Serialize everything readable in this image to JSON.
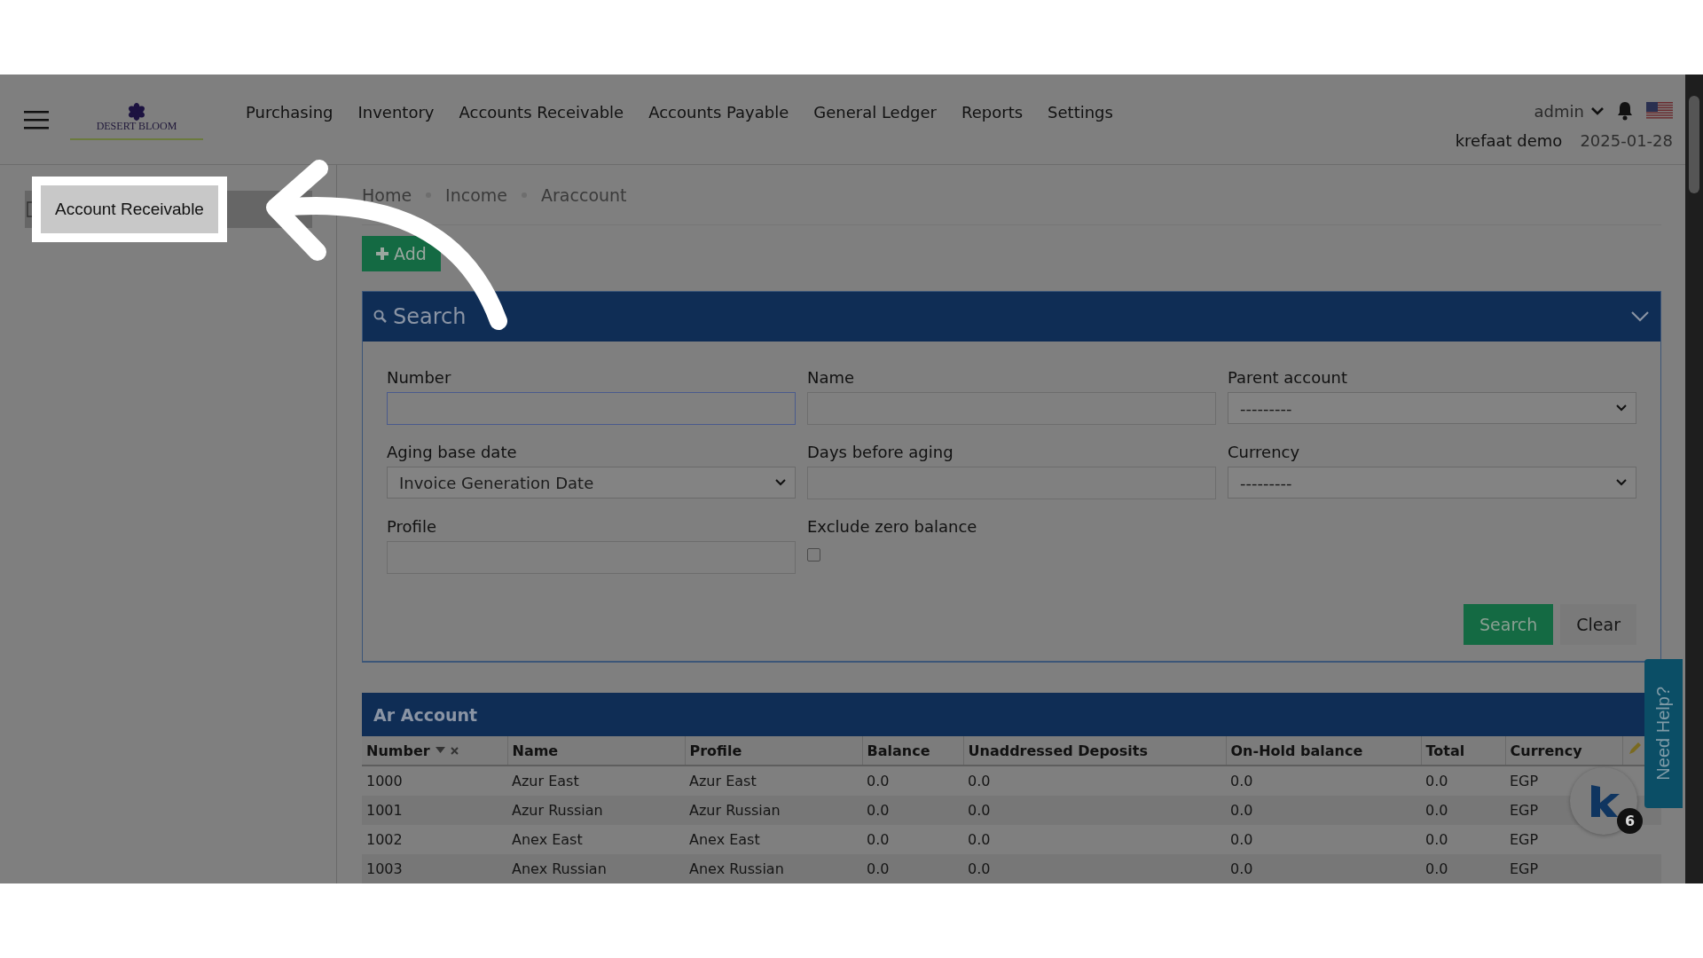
{
  "header": {
    "logo": "DESERT BLOOM",
    "nav": [
      "Purchasing",
      "Inventory",
      "Accounts Receivable",
      "Accounts Payable",
      "General Ledger",
      "Reports",
      "Settings"
    ],
    "user": "admin",
    "company": "krefaat demo",
    "date": "2025-01-28"
  },
  "sidebar": {
    "items": [
      {
        "label": "Account Receivable",
        "selected": true
      }
    ]
  },
  "breadcrumb": [
    "Home",
    "Income",
    "Araccount"
  ],
  "add_button": "Add",
  "search": {
    "title": "Search",
    "expanded": true,
    "fields": [
      {
        "kind": "text",
        "label": "Number",
        "focused": true
      },
      {
        "kind": "text",
        "label": "Name",
        "focused": false
      },
      {
        "kind": "select",
        "label": "Parent account",
        "value": "---------"
      },
      {
        "kind": "select",
        "label": "Aging base date",
        "value": "Invoice Generation Date"
      },
      {
        "kind": "text",
        "label": "Days before aging",
        "focused": false
      },
      {
        "kind": "select",
        "label": "Currency",
        "value": "---------"
      },
      {
        "kind": "text",
        "label": "Profile",
        "focused": false
      },
      {
        "kind": "checkbox",
        "label": "Exclude zero balance",
        "checked": false
      }
    ],
    "buttons": [
      {
        "kind": "primary",
        "label": "Search"
      },
      {
        "kind": "secondary",
        "label": "Clear"
      }
    ]
  },
  "table": {
    "title": "Ar Account",
    "columns": [
      {
        "label": "Number",
        "sorted": true
      },
      {
        "label": "Name",
        "sorted": false
      },
      {
        "label": "Profile",
        "sorted": false
      },
      {
        "label": "Balance",
        "sorted": false
      },
      {
        "label": "Unaddressed Deposits",
        "sorted": false
      },
      {
        "label": "On-Hold balance",
        "sorted": false
      },
      {
        "label": "Total",
        "sorted": false
      },
      {
        "label": "Currency",
        "sorted": false
      }
    ],
    "rows": [
      [
        "1000",
        "Azur East",
        "Azur East",
        "0.0",
        "0.0",
        "0.0",
        "0.0",
        "EGP"
      ],
      [
        "1001",
        "Azur Russian",
        "Azur Russian",
        "0.0",
        "0.0",
        "0.0",
        "0.0",
        "EGP"
      ],
      [
        "1002",
        "Anex East",
        "Anex East",
        "0.0",
        "0.0",
        "0.0",
        "0.0",
        "EGP"
      ],
      [
        "1003",
        "Anex Russian",
        "Anex Russian",
        "0.0",
        "0.0",
        "0.0",
        "0.0",
        "EGP"
      ]
    ]
  },
  "help_tab": "Need Help?",
  "chat_badge": {
    "count": "6"
  }
}
